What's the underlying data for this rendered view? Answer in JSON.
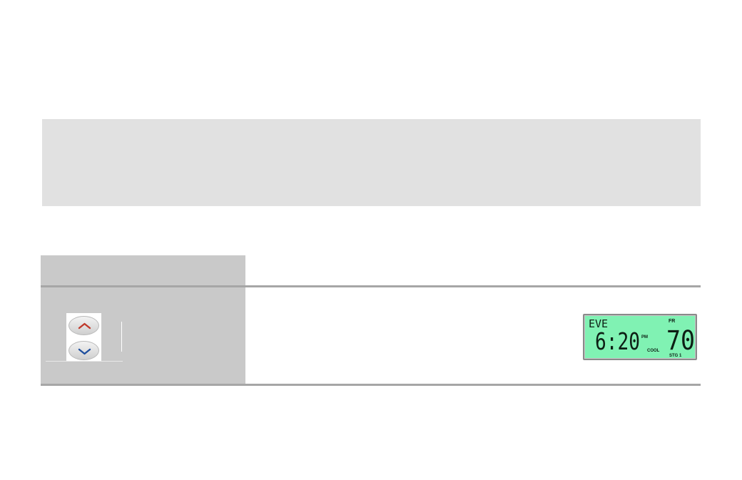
{
  "thermostat": {
    "up_button_icon": "chevron-up-icon",
    "down_button_icon": "chevron-down-icon",
    "colors": {
      "up_arrow": "#c0392b",
      "down_arrow": "#1f4f9e",
      "lcd_background": "#80f2b3",
      "lcd_text": "#0d1f14"
    },
    "display": {
      "period": "EVE",
      "time": "6:20",
      "meridiem": "PM",
      "day": "FR",
      "mode": "COOL",
      "setpoint": "70",
      "stage": "STG 1"
    }
  }
}
